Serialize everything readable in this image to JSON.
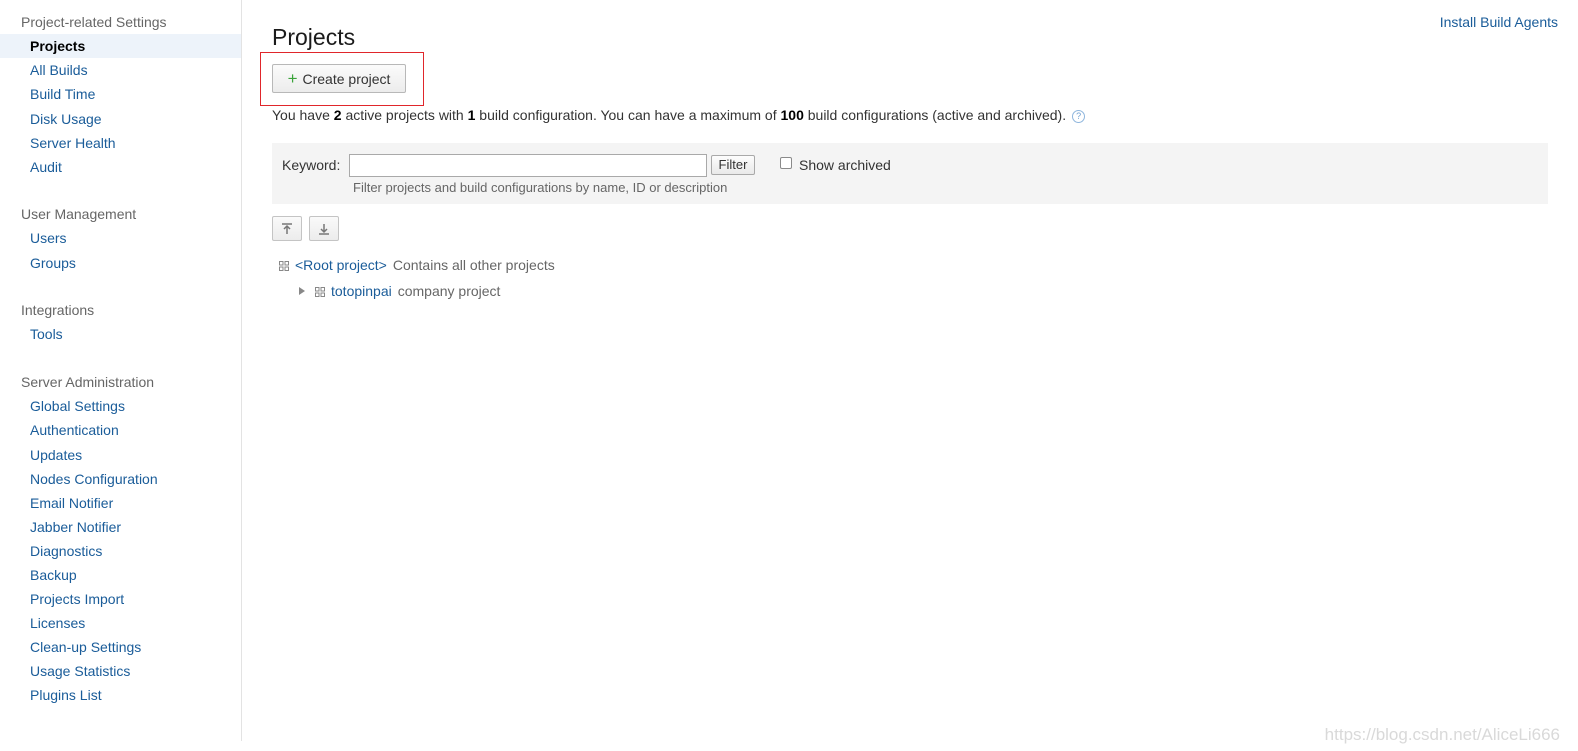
{
  "sidebar": {
    "groups": [
      {
        "title": "Project-related Settings",
        "items": [
          "Projects",
          "All Builds",
          "Build Time",
          "Disk Usage",
          "Server Health",
          "Audit"
        ]
      },
      {
        "title": "User Management",
        "items": [
          "Users",
          "Groups"
        ]
      },
      {
        "title": "Integrations",
        "items": [
          "Tools"
        ]
      },
      {
        "title": "Server Administration",
        "items": [
          "Global Settings",
          "Authentication",
          "Updates",
          "Nodes Configuration",
          "Email Notifier",
          "Jabber Notifier",
          "Diagnostics",
          "Backup",
          "Projects Import",
          "Licenses",
          "Clean-up Settings",
          "Usage Statistics",
          "Plugins List"
        ]
      }
    ],
    "active_item": "Projects"
  },
  "header": {
    "title": "Projects",
    "install_agents_link": "Install Build Agents"
  },
  "actions": {
    "create_project": "Create project"
  },
  "summary": {
    "p1": "You have ",
    "active_projects": "2",
    "p2": " active projects with ",
    "build_configs": "1",
    "p3": " build configuration. You can have a maximum of ",
    "max_configs": "100",
    "p4": " build configurations (active and archived).",
    "help_glyph": "?"
  },
  "filter": {
    "keyword_label": "Keyword:",
    "keyword_value": "",
    "filter_button": "Filter",
    "show_archived_label": "Show archived",
    "show_archived_checked": false,
    "hint": "Filter projects and build configurations by name, ID or description"
  },
  "toolbar": {
    "collapse_all_icon": "collapse-all-icon",
    "expand_all_icon": "expand-all-icon"
  },
  "tree": {
    "root": {
      "name": "<Root project>",
      "description": "Contains all other projects"
    },
    "children": [
      {
        "name": "totopinpai",
        "description": "company project",
        "expanded": false
      }
    ]
  },
  "watermark": "https://blog.csdn.net/AliceLi666",
  "colors": {
    "link": "#1a5c99",
    "active_bg": "#edf3fa",
    "highlight_border": "#e0262b",
    "plus": "#3aa33a"
  }
}
